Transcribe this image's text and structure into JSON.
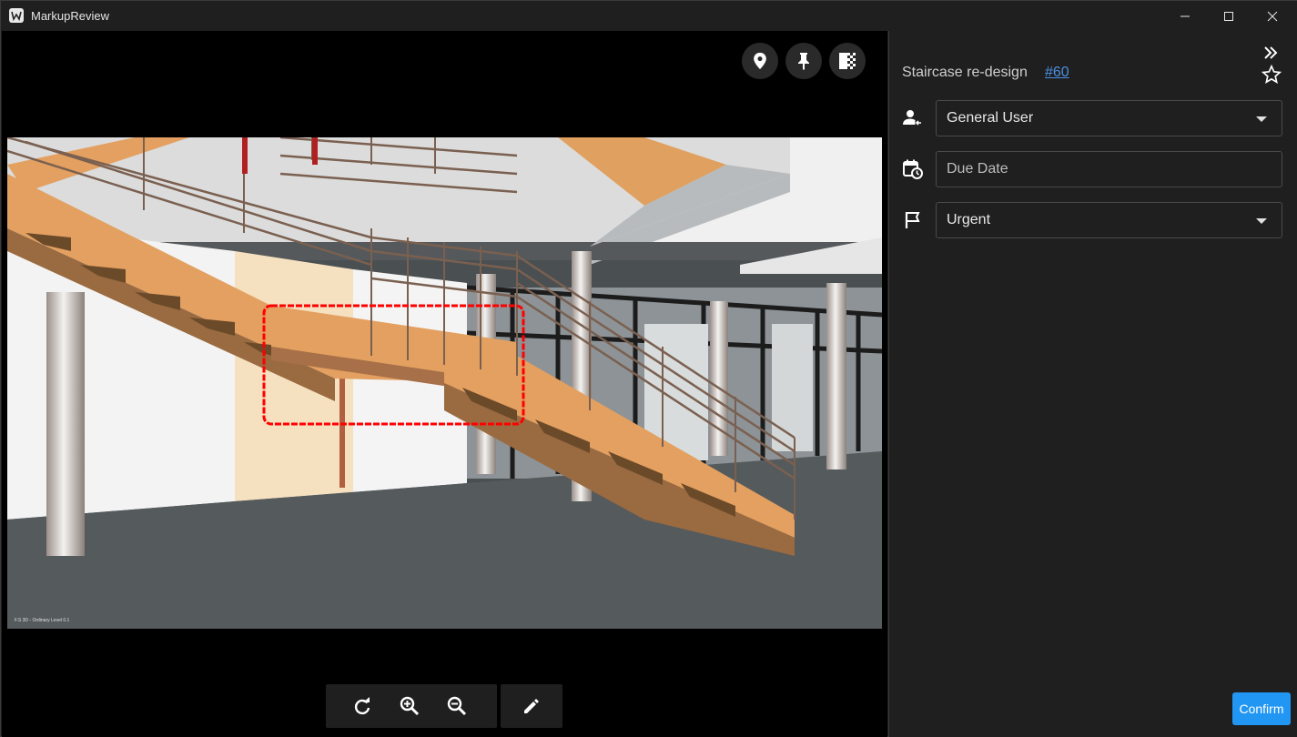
{
  "window": {
    "app_title": "MarkupReview",
    "icon": "app-logo-icon"
  },
  "viewer": {
    "top_actions": [
      {
        "icon": "location-pin-icon"
      },
      {
        "icon": "push-pin-icon"
      },
      {
        "icon": "compare-overlay-icon"
      }
    ],
    "toolbar": [
      {
        "icon": "rotate-icon"
      },
      {
        "icon": "zoom-in-icon"
      },
      {
        "icon": "zoom-out-icon"
      },
      {
        "icon": "pencil-icon"
      }
    ],
    "image_caption": "F.S 3D - Ordinary Level 0.1"
  },
  "panel": {
    "issue_title": "Staircase re-design",
    "issue_number": "#60",
    "assignee": "General User",
    "due_date_placeholder": "Due Date",
    "priority": "Urgent",
    "confirm_label": "Confirm"
  },
  "colors": {
    "accent": "#2196f3",
    "link": "#4a90e2",
    "markup_cloud": "#ff0000"
  }
}
